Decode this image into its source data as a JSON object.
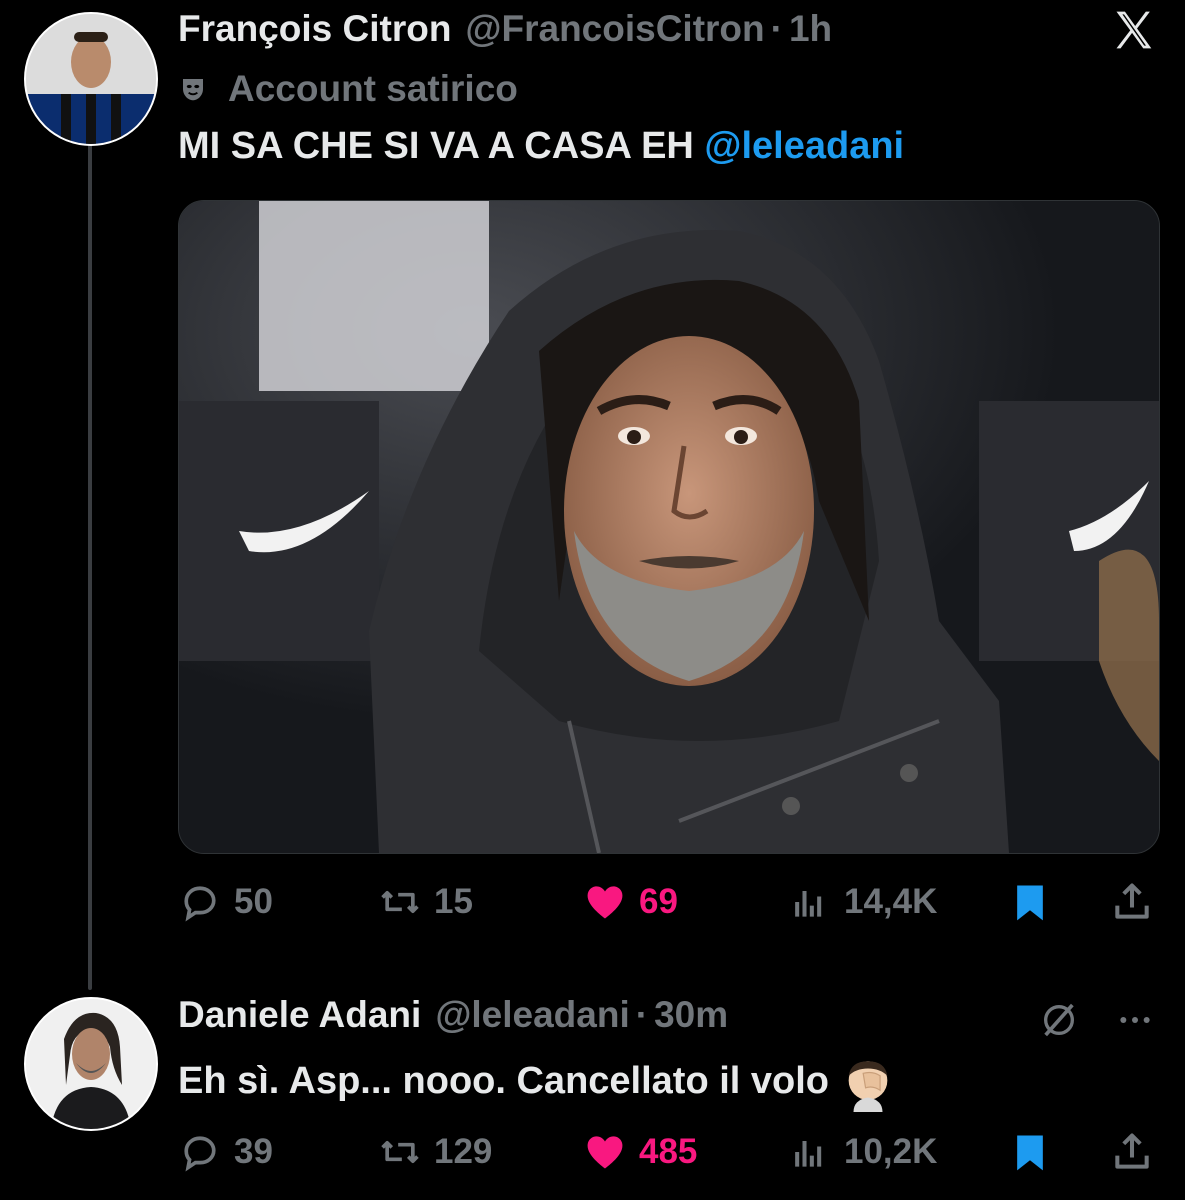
{
  "tweet": {
    "author_name": "François Citron",
    "author_handle": "@FrancoisCitron",
    "separator": "·",
    "time": "1h",
    "badge_label": "Account satirico",
    "text_main": "MI SA CHE SI VA A CASA EH ",
    "text_mention": "@leleadani",
    "stats": {
      "replies": "50",
      "reposts": "15",
      "likes": "69",
      "views": "14,4K"
    }
  },
  "reply": {
    "author_name": "Daniele Adani",
    "author_handle": "@leleadani",
    "separator": "·",
    "time": "30m",
    "text": "Eh sì. Asp... nooo. Cancellato il volo",
    "stats": {
      "replies": "39",
      "reposts": "129",
      "likes": "485",
      "views": "10,2K"
    }
  },
  "colors": {
    "background": "#000000",
    "text": "#e7e9ea",
    "muted": "#71767b",
    "link": "#1d9bf0",
    "like": "#f91880",
    "bookmark": "#1d9bf0"
  },
  "icons": [
    "x-logo-icon",
    "mask-icon",
    "reply-icon",
    "repost-icon",
    "heart-icon",
    "views-icon",
    "bookmark-icon",
    "share-icon",
    "grok-icon",
    "more-icon",
    "facepalm-emoji-icon"
  ]
}
